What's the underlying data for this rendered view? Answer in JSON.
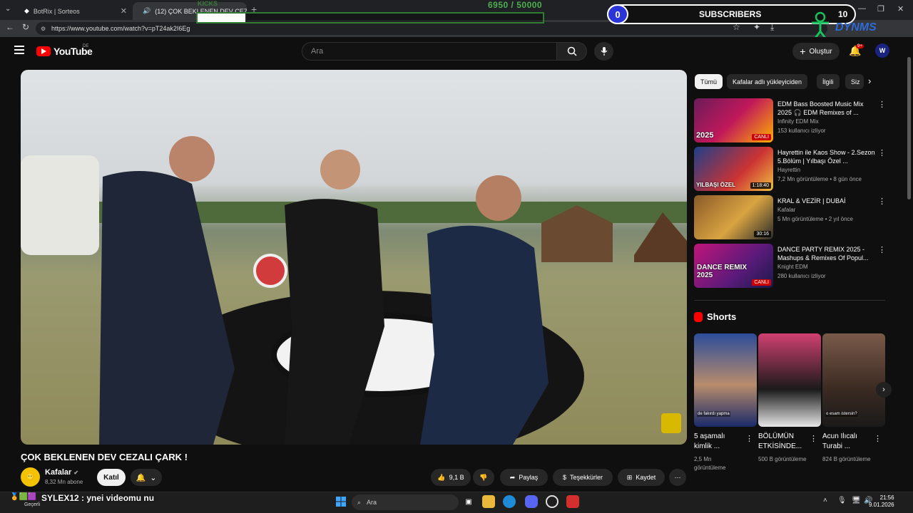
{
  "browser": {
    "tabs": [
      {
        "label": "BotRix | Sorteos",
        "active": false
      },
      {
        "label": "(12) ÇOK BEKLENEN DEV CEZ",
        "active": true
      }
    ],
    "url": "https://www.youtube.com/watch?v=pT24ak2I6Eg"
  },
  "overlay": {
    "kicks_label": "KICKS",
    "goal_current": "6950",
    "goal_total": "/ 50000",
    "goal_fraction": 0.139,
    "sub_count_left": "0",
    "sub_title": "SUBSCRIBERS",
    "sub_count_right": "10",
    "brand_text": "DYNMS"
  },
  "youtube": {
    "logo_text": "YouTube",
    "region": "DE",
    "search_placeholder": "Ara",
    "create_label": "Oluştur",
    "notif_badge": "9+",
    "avatar_letter": "W"
  },
  "video": {
    "title": "ÇOK BEKLENEN DEV CEZALI ÇARK !",
    "channel": "Kafalar",
    "subscribers": "8,32 Mn abone",
    "join_label": "Katıl",
    "likes": "9,1 B",
    "share_label": "Paylaş",
    "thanks_label": "Teşekkürler",
    "save_label": "Kaydet"
  },
  "chips": [
    "Tümü",
    "Kafalar adlı yükleyiciden",
    "İlgili",
    "Siz"
  ],
  "recommendations": [
    {
      "title": "EDM Bass Boosted Music Mix 2025 🎧 EDM Remixes of ...",
      "channel": "Infinity EDM Mix",
      "meta": "153 kullanıcı izliyor",
      "tag": "CANLI",
      "badge": "2025"
    },
    {
      "title": "Hayrettin ile Kaos Show - 2.Sezon 5.Bölüm | Yılbaşı Özel ...",
      "channel": "Hayrettin",
      "meta": "7,2 Mn görüntüleme • 8 gün önce",
      "tag": "1:18:40",
      "badge": "YILBAŞI ÖZEL"
    },
    {
      "title": "KRAL & VEZİR | DUBAİ",
      "channel": "Kafalar",
      "meta": "5 Mn görüntüleme • 2 yıl önce",
      "tag": "30:16",
      "badge": ""
    },
    {
      "title": "DANCE PARTY REMIX 2025 - Mashups & Remixes Of Popul...",
      "channel": "Knight EDM",
      "meta": "280 kullanıcı izliyor",
      "tag": "CANLI",
      "badge": "DANCE REMIX 2025"
    }
  ],
  "shorts": {
    "heading": "Shorts",
    "items": [
      {
        "title": "5 aşamalı kimlik ...",
        "views": "2,5 Mn görüntüleme",
        "caption": "de fakırdı yapma"
      },
      {
        "title": "BÖLÜMÜN ETKİSİNDE...",
        "views": "500 B görüntüleme",
        "caption": ""
      },
      {
        "title": "Acun Ilıcalı Turabi ...",
        "views": "824 B görüntüleme",
        "caption": "o esam istersin?"
      }
    ]
  },
  "taskbar": {
    "chat_line": "SYLEX12 : ynei videomu nu",
    "weather": "Geçerli",
    "search_label": "Ara",
    "time": "21:56",
    "date": "9.01.2026"
  }
}
